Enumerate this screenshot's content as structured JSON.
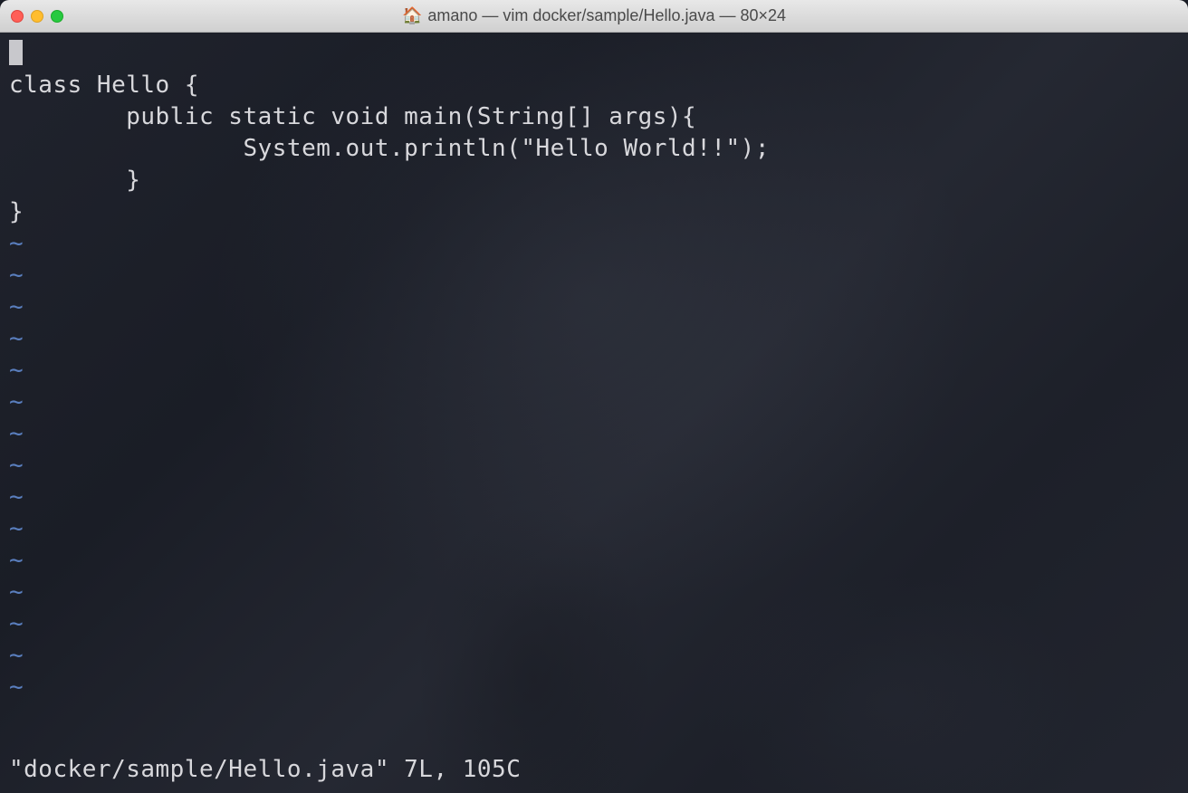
{
  "titlebar": {
    "title": "amano — vim docker/sample/Hello.java — 80×24"
  },
  "editor": {
    "lines": [
      "",
      "class Hello {",
      "",
      "        public static void main(String[] args){",
      "                System.out.println(\"Hello World!!\");",
      "        }",
      "}"
    ],
    "tilde_count": 15,
    "tilde_char": "~"
  },
  "status": {
    "text": "\"docker/sample/Hello.java\" 7L, 105C"
  }
}
